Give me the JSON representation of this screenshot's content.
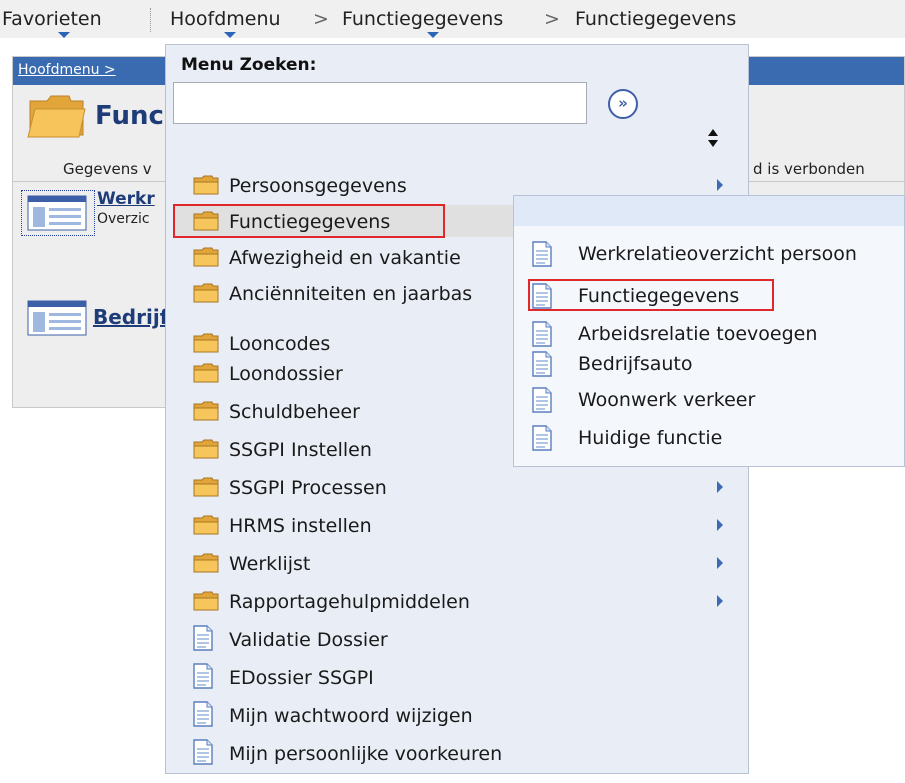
{
  "topnav": {
    "favorites": "Favorieten",
    "main_menu": "Hoofdmenu",
    "separator": ">",
    "crumb_1": "Functiegegevens",
    "crumb_2": "Functiegegevens"
  },
  "background": {
    "crumb": "Hoofdmenu >",
    "title": "Func",
    "subtext": "Gegevens v",
    "right_text": "d is verbonden",
    "link_1": "Werkr",
    "desc_1": "Overzic",
    "link_2": "Bedrijf"
  },
  "main_menu": {
    "search_label": "Menu Zoeken:",
    "search_value": "",
    "go_label": "»",
    "items": [
      {
        "label": "Persoonsgegevens",
        "icon": "folder-icon",
        "submenu": true
      },
      {
        "label": "Functiegegevens",
        "icon": "folder-icon",
        "submenu": false,
        "highlighted": true
      },
      {
        "label": "Afwezigheid en vakantie",
        "icon": "folder-icon",
        "submenu": false
      },
      {
        "label": "Anciënniteiten en jaarbas",
        "icon": "folder-icon",
        "submenu": false
      },
      {
        "label": "Looncodes",
        "icon": "folder-icon",
        "submenu": false
      },
      {
        "label": "Loondossier",
        "icon": "folder-icon",
        "submenu": false
      },
      {
        "label": "Schuldbeheer",
        "icon": "folder-icon",
        "submenu": false
      },
      {
        "label": "SSGPI Instellen",
        "icon": "folder-icon",
        "submenu": false
      },
      {
        "label": "SSGPI Processen",
        "icon": "folder-icon",
        "submenu": true
      },
      {
        "label": "HRMS instellen",
        "icon": "folder-icon",
        "submenu": true
      },
      {
        "label": "Werklijst",
        "icon": "folder-icon",
        "submenu": true
      },
      {
        "label": "Rapportagehulpmiddelen",
        "icon": "folder-icon",
        "submenu": true
      },
      {
        "label": "Validatie Dossier",
        "icon": "document-icon",
        "submenu": false
      },
      {
        "label": "EDossier SSGPI",
        "icon": "document-icon",
        "submenu": false
      },
      {
        "label": "Mijn wachtwoord wijzigen",
        "icon": "document-icon",
        "submenu": false
      },
      {
        "label": "Mijn persoonlijke voorkeuren",
        "icon": "document-icon",
        "submenu": false
      }
    ]
  },
  "submenu": {
    "items": [
      {
        "label": "Werkrelatieoverzicht persoon",
        "icon": "document-icon"
      },
      {
        "label": "Functiegegevens",
        "icon": "document-icon",
        "highlighted": true
      },
      {
        "label": "Arbeidsrelatie toevoegen",
        "icon": "document-icon"
      },
      {
        "label": "Bedrijfsauto",
        "icon": "document-icon"
      },
      {
        "label": "Woonwerk verkeer",
        "icon": "document-icon"
      },
      {
        "label": "Huidige functie",
        "icon": "document-icon"
      }
    ]
  },
  "colors": {
    "highlight_border": "#e0282b",
    "menu_bg": "#e9eef6",
    "link": "#1e3c78",
    "topbar": "#3a6bb1"
  }
}
